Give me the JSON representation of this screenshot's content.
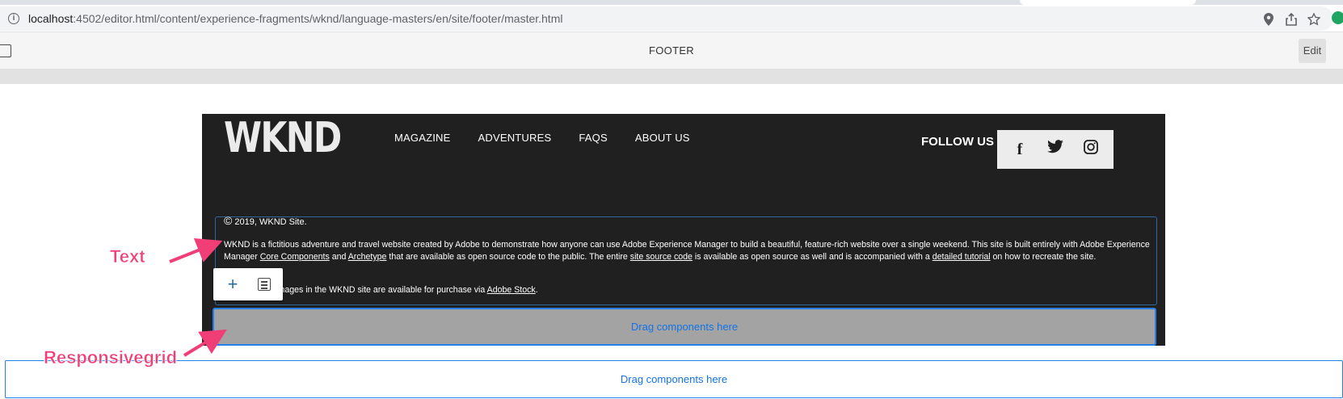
{
  "browser": {
    "url_host": "localhost",
    "url_path": ":4502/editor.html/content/experience-fragments/wknd/language-masters/en/site/footer/master.html"
  },
  "editor": {
    "page_title": "FOOTER",
    "edit_label": "Edit"
  },
  "footer": {
    "logo": "WKND",
    "nav": [
      "MAGAZINE",
      "ADVENTURES",
      "FAQS",
      "ABOUT US"
    ],
    "follow_label": "FOLLOW US",
    "social": [
      "facebook-icon",
      "twitter-icon",
      "instagram-icon"
    ],
    "copyright_symbol": "©",
    "copyright_text": "2019, WKND Site.",
    "para_part1": "WKND is a fictitious adventure and travel website created by Adobe to demonstrate how anyone can use Adobe Experience Manager to build a beautiful, feature-rich website over a single weekend. This site is built entirely with Adobe Experience Manager ",
    "link_core": "Core Components",
    "para_and": " and ",
    "link_archetype": "Archetype",
    "para_part2": " that are available as open source code to the public. The entire ",
    "link_source": "site source code",
    "para_part3": " is available as open source as well and is accompanied with a ",
    "link_tutorial": "detailed tutorial",
    "para_part4": " on how to recreate the site.",
    "para2_part1": "The beautiful images in the WKND site are available for purchase via ",
    "link_stock": "Adobe Stock",
    "para2_end": ".",
    "inner_dropzone": "Drag components here"
  },
  "outer_dropzone": "Drag components here",
  "annotations": {
    "text": "Text",
    "grid": "Responsivegrid"
  },
  "colors": {
    "accent": "#2680eb",
    "annotation": "#f23e77",
    "footer_bg": "#202020"
  }
}
